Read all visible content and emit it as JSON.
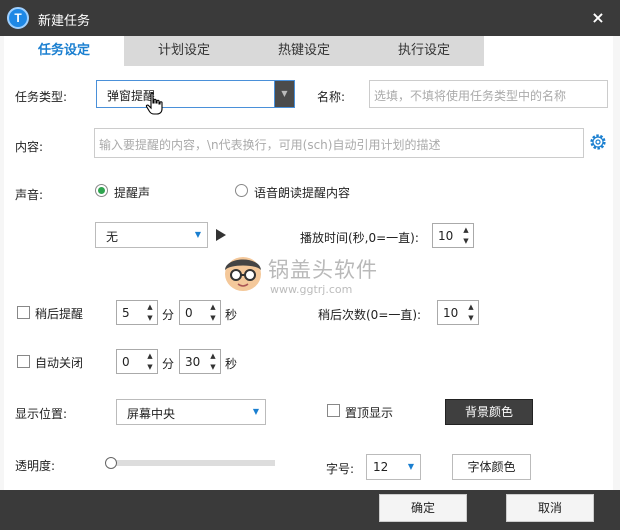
{
  "window": {
    "title": "新建任务",
    "close": "×"
  },
  "app_icon": {
    "letter": "T"
  },
  "tabs": [
    {
      "label": "任务设定",
      "active": true
    },
    {
      "label": "计划设定",
      "active": false
    },
    {
      "label": "热键设定",
      "active": false
    },
    {
      "label": "执行设定",
      "active": false
    }
  ],
  "task_type": {
    "label": "任务类型:",
    "value": "弹窗提醒"
  },
  "name": {
    "label": "名称:",
    "placeholder": "选填，不填将使用任务类型中的名称"
  },
  "content": {
    "label": "内容:",
    "placeholder": "输入要提醒的内容，\\n代表换行，可用(sch)自动引用计划的描述"
  },
  "sound": {
    "label": "声音:",
    "option_beep": "提醒声",
    "option_tts": "语音朗读提醒内容",
    "selected": "提醒声",
    "sound_value": "无",
    "duration_label": "播放时间(秒,0=一直):",
    "duration_value": "10"
  },
  "snooze": {
    "label": "稍后提醒",
    "minutes": "5",
    "min_unit": "分",
    "seconds": "0",
    "sec_unit": "秒",
    "count_label": "稍后次数(0=一直):",
    "count_value": "10"
  },
  "auto_close": {
    "label": "自动关闭",
    "minutes": "0",
    "min_unit": "分",
    "seconds": "30",
    "sec_unit": "秒"
  },
  "position": {
    "label": "显示位置:",
    "value": "屏幕中央",
    "topmost_label": "置顶显示",
    "bg_color_button": "背景颜色"
  },
  "opacity": {
    "label": "透明度:",
    "font_size_label": "字号:",
    "font_size_value": "12",
    "font_color_button": "字体颜色"
  },
  "watermark": {
    "text": "锅盖头软件",
    "url": "www.ggtrj.com"
  },
  "footer": {
    "ok": "确定",
    "cancel": "取消"
  },
  "colors": {
    "accent": "#1a7fd0",
    "dark": "#3a3a3a",
    "radio_green": "#2fa44f"
  }
}
